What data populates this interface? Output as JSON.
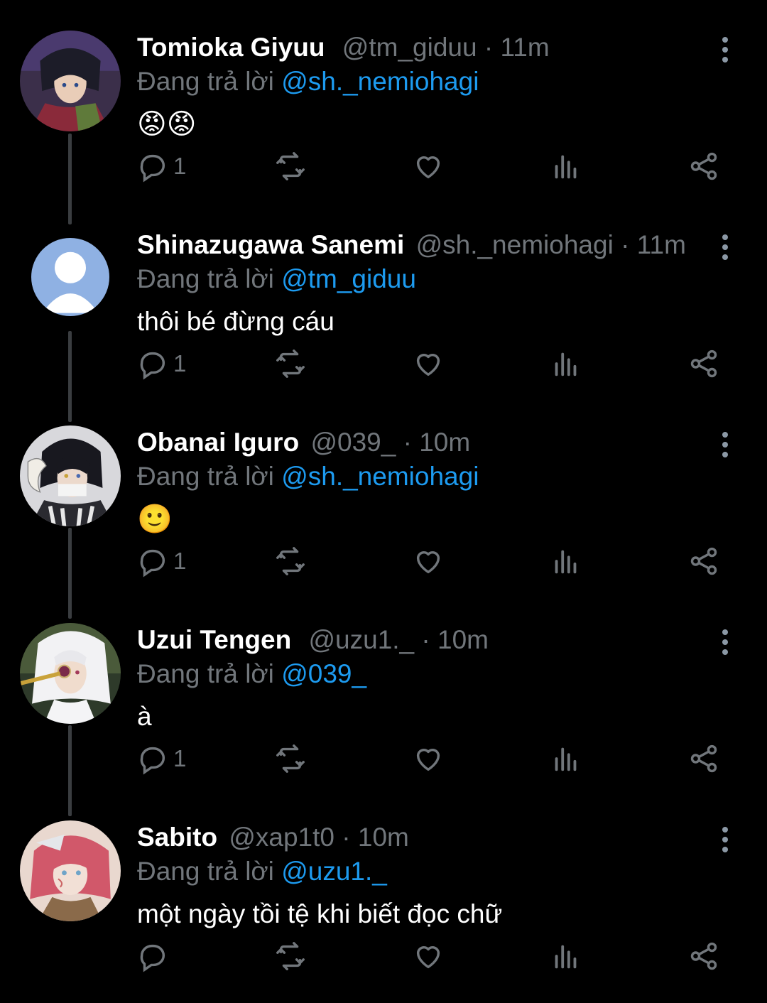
{
  "reply_prefix": "Đang trả lời",
  "icons": {
    "reply": "reply-bubble-icon",
    "retweet": "retweet-icon",
    "like": "heart-icon",
    "views": "analytics-icon",
    "share": "share-icon",
    "more": "more-vertical-icon"
  },
  "colors": {
    "background": "#000000",
    "name": "#ffffff",
    "muted": "#71767b",
    "mention": "#1d9bf0",
    "thread_line": "#3a3d40"
  },
  "tweets": [
    {
      "name": "Tomioka Giyuu",
      "handle": "@tm_giduu",
      "time": "11m",
      "reply_to": "@sh._nemiohagi",
      "text": "😡😡",
      "reply_count": "1"
    },
    {
      "name": "Shinazugawa Sanemi",
      "handle": "@sh._nemiohagi",
      "time": "11m",
      "reply_to": "@tm_giduu",
      "text": "thôi bé đừng cáu",
      "reply_count": "1"
    },
    {
      "name": "Obanai Iguro",
      "handle": "@039_",
      "time": "10m",
      "reply_to": "@sh._nemiohagi",
      "text": "🙂",
      "reply_count": "1"
    },
    {
      "name": "Uzui Tengen",
      "handle": "@uzu1._",
      "time": "10m",
      "reply_to": "@039_",
      "text": "à",
      "reply_count": "1"
    },
    {
      "name": "Sabito",
      "handle": "@xap1t0",
      "time": "10m",
      "reply_to": "@uzu1._",
      "text": "một ngày tồi tệ khi biết đọc chữ",
      "reply_count": ""
    }
  ]
}
